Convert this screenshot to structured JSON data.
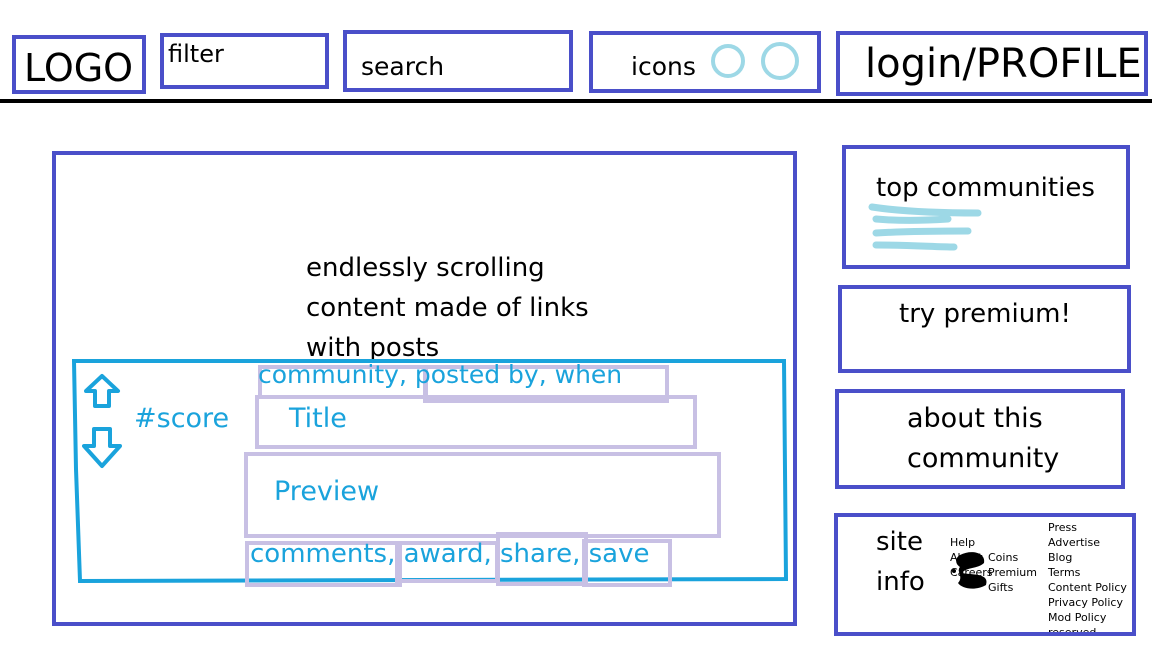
{
  "header": {
    "logo": "LOGO",
    "filter": "filter",
    "search": "search",
    "icons": "icons",
    "login": "login/PROFILE"
  },
  "feed": {
    "lines": [
      "endlessly scrolling",
      "content made of links",
      "with posts"
    ],
    "post": {
      "meta": "community, posted by, when",
      "score": "#score",
      "title": "Title",
      "preview": "Preview",
      "actions": "comments, award, share, save"
    }
  },
  "sidebar": {
    "top_communities": "top communities",
    "premium": "try premium!",
    "about_line1": "about this",
    "about_line2": "community",
    "site_info_line1": "site",
    "site_info_line2": "info",
    "links_col1": [
      "Help",
      "",
      "",
      "",
      "About",
      "Careers"
    ],
    "links_col2": [
      "Coins",
      "Premium",
      "Gifts"
    ],
    "links_col3": [
      "Press",
      "Advertise",
      "Blog",
      "Terms",
      "Content Policy",
      "Privacy Policy",
      "Mod Policy",
      "reserved"
    ]
  },
  "colors": {
    "border": "#4a4fc9",
    "post_border": "#1aa3dc",
    "light_border": "#c8c0e4",
    "icon_circle": "#9dd8e6",
    "text_accent": "#1aa3dc"
  }
}
